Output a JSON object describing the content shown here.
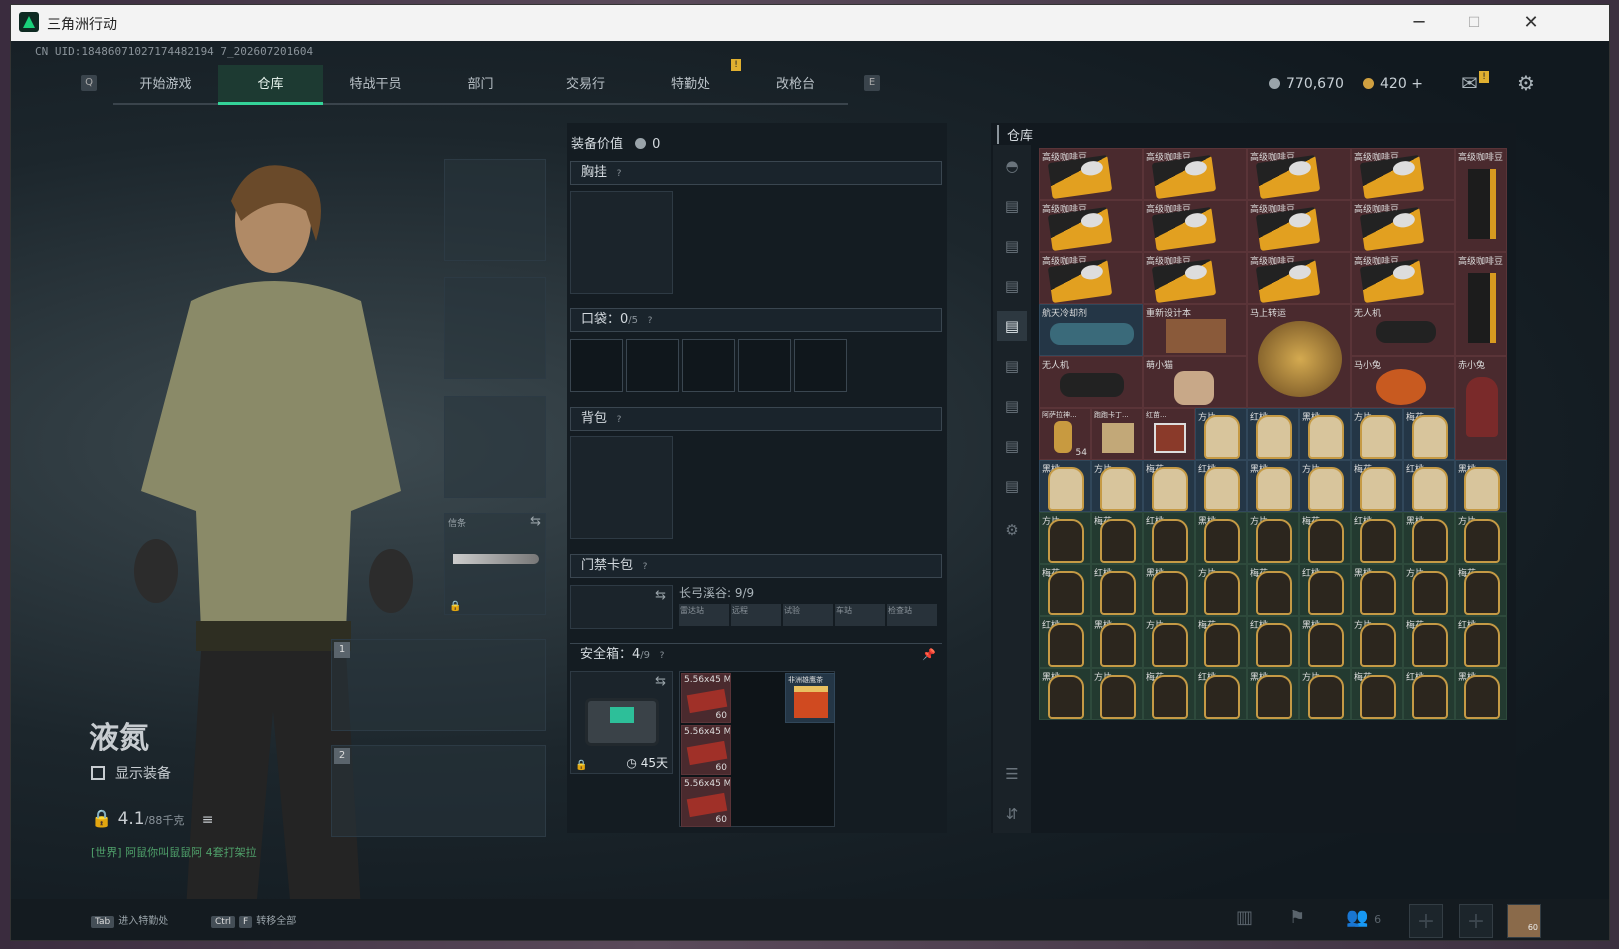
{
  "window": {
    "title": "三角洲行动"
  },
  "header": {
    "uid": "CN UID:18486071027174482194 7_202607201604"
  },
  "tabs": [
    {
      "label": "开始游戏"
    },
    {
      "label": "仓库"
    },
    {
      "label": "特战干员"
    },
    {
      "label": "部门"
    },
    {
      "label": "交易行"
    },
    {
      "label": "特勤处"
    },
    {
      "label": "改枪台"
    }
  ],
  "tab_keys": {
    "left": "Q",
    "right": "E"
  },
  "currency": {
    "silver": "770,670",
    "gold": "420"
  },
  "character": {
    "name": "液氮",
    "show_gear": "显示装备",
    "weight": "4.1",
    "weight_max": "/88千克",
    "chat": "[世界] 阿鼠你叫鼠鼠阿 4套打架拉"
  },
  "slots": {
    "melee_label": "信条",
    "primary_num": "1",
    "secondary_num": "2"
  },
  "loadout": {
    "value_label": "装备价值",
    "value": "0",
    "chest": "胸挂",
    "pockets_label": "口袋：",
    "pockets_used": "0",
    "pockets_max": "/5",
    "backpack": "背包",
    "keycase": "门禁卡包",
    "keycase_map": "长弓溪谷: 9/9",
    "keycase_items": [
      "雷达站",
      "远程",
      "试验",
      "车站",
      "检查站"
    ],
    "safe_label": "安全箱：",
    "safe_used": "4",
    "safe_max": "/9",
    "safe_time": "45天",
    "safe_items": [
      {
        "label": "5.56x45 M855",
        "count": "60"
      },
      {
        "label": "5.56x45 M855",
        "count": "60"
      },
      {
        "label": "5.56x45 M855",
        "count": "60"
      },
      {
        "label": "非洲雄鹰茶"
      }
    ]
  },
  "warehouse": {
    "title": "仓库",
    "items": [
      {
        "label": "高级咖啡豆"
      },
      {
        "label": "高级咖啡豆"
      },
      {
        "label": "高级咖啡豆"
      },
      {
        "label": "高级咖啡豆"
      },
      {
        "label": "高级咖啡豆"
      },
      {
        "label": "航天冷却剂"
      },
      {
        "label": "重新设计本"
      },
      {
        "label": "马上转运"
      },
      {
        "label": "无人机"
      },
      {
        "label": "无人机"
      },
      {
        "label": "萌小猫"
      },
      {
        "label": "马小兔"
      },
      {
        "label": "赤小兔"
      },
      {
        "label": "阿萨拉神..."
      },
      {
        "label": "跑跑卡丁..."
      },
      {
        "label": "红苗..."
      },
      {
        "label": "方片"
      },
      {
        "label": "红桃"
      },
      {
        "label": "黑桃"
      },
      {
        "label": "方片"
      },
      {
        "label": "梅花"
      },
      {
        "label": "54"
      }
    ],
    "tag_labels": [
      "黑桃",
      "方片",
      "梅花",
      "红桃"
    ]
  },
  "bottom": {
    "hint1_key": "Tab",
    "hint1": "进入特勤处",
    "hint2_key1": "Ctrl",
    "hint2_key2": "F",
    "hint2": "转移全部",
    "squad": "6",
    "avatar_count": "60"
  },
  "colors": {
    "accent": "#34d399",
    "red_cell": "#4a2a2e",
    "blue_cell": "#243646",
    "green_cell": "#233a30"
  }
}
